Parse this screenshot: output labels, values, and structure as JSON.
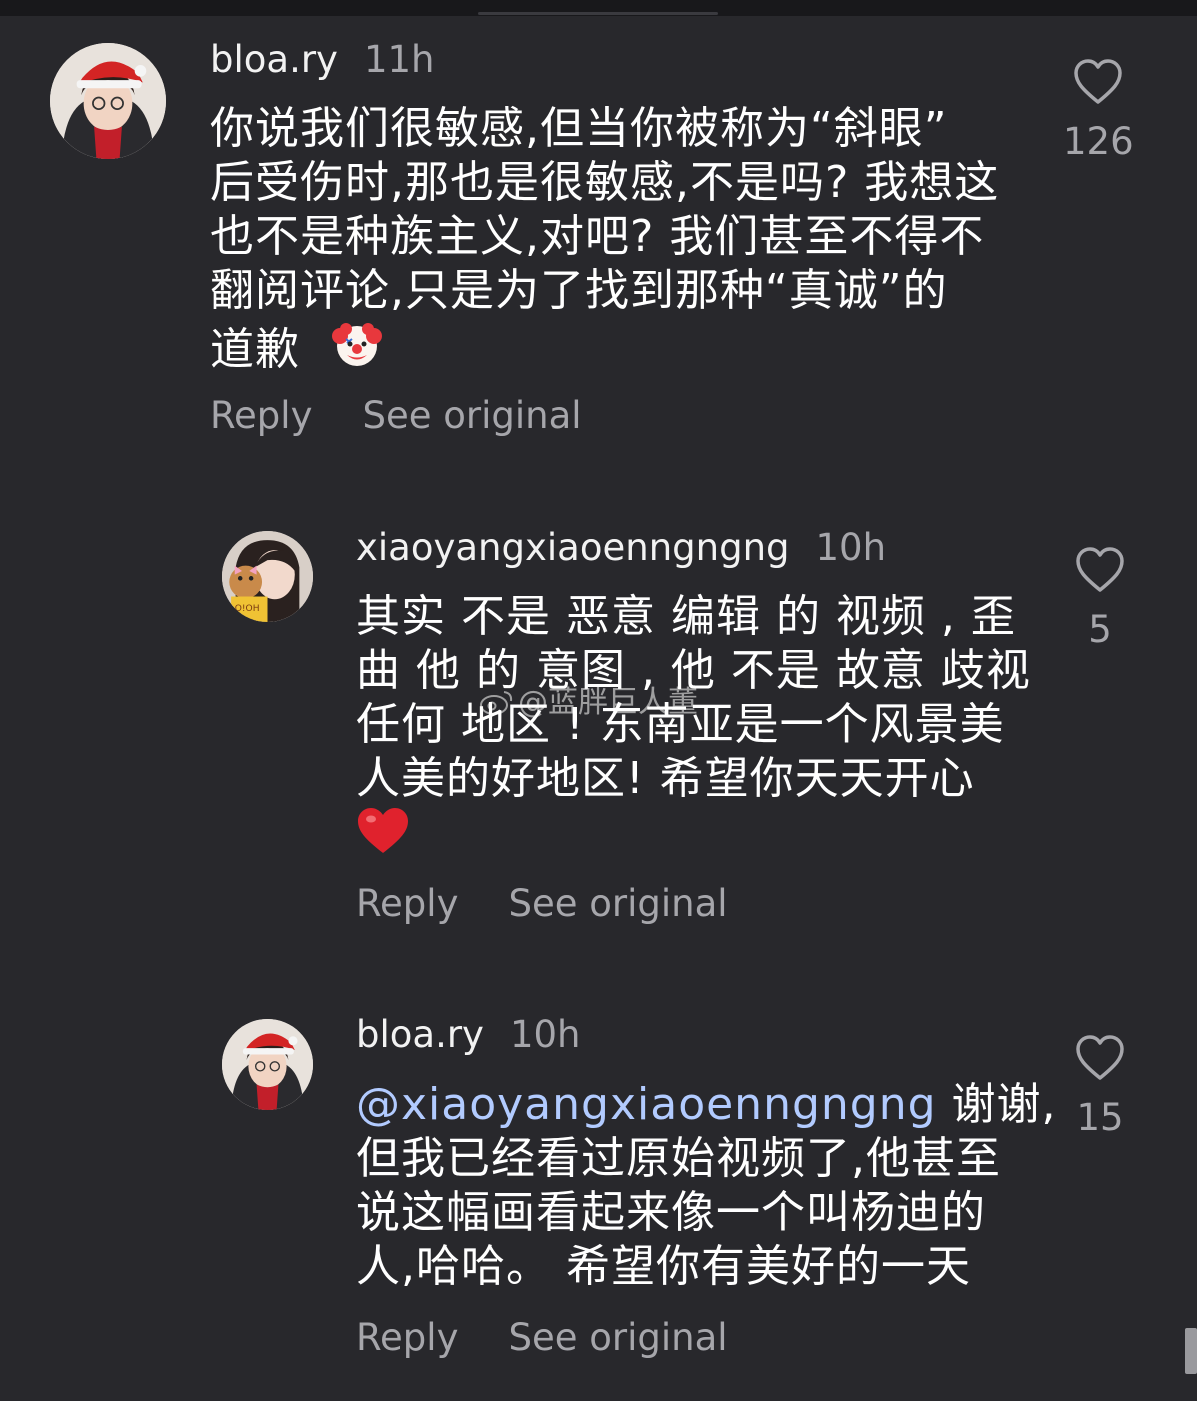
{
  "comments": [
    {
      "username": "bloa.ry",
      "time": "11h",
      "lines": [
        "你说我们很敏感,但当你被称为“斜眼”",
        "后受伤时,那也是很敏感,不是吗? 我想这",
        "也不是种族主义,对吧? 我们甚至不得不",
        "翻阅评论,只是为了找到那种“真诚”的",
        "道歉"
      ],
      "emoji": "clown-face-emoji",
      "like_count": "126",
      "reply_label": "Reply",
      "see_original_label": "See original"
    },
    {
      "username": "xiaoyangxiaoenngngng",
      "time": "10h",
      "lines": [
        "其实 不是 恶意 编辑 的 视频 , 歪",
        "曲 他 的 意图 , 他 不是 故意 歧视",
        "任何 地区 ! 东南亚是一个风景美",
        "人美的好地区! 希望你天天开心"
      ],
      "emoji": "red-heart-emoji",
      "like_count": "5",
      "reply_label": "Reply",
      "see_original_label": "See original"
    },
    {
      "username": "bloa.ry",
      "time": "10h",
      "mention": "@xiaoyangxiaoenngngng",
      "first_line_rest": " 谢谢,",
      "lines": [
        "但我已经看过原始视频了,他甚至",
        "说这幅画看起来像一个叫杨迪的",
        "人,哈哈。 希望你有美好的一天"
      ],
      "like_count": "15",
      "reply_label": "Reply",
      "see_original_label": "See original"
    }
  ],
  "watermark": "@蓝胖巨人董",
  "colors": {
    "background": "#28282c",
    "secondary_text": "#a6a6ab",
    "mention": "#b2cbff"
  }
}
